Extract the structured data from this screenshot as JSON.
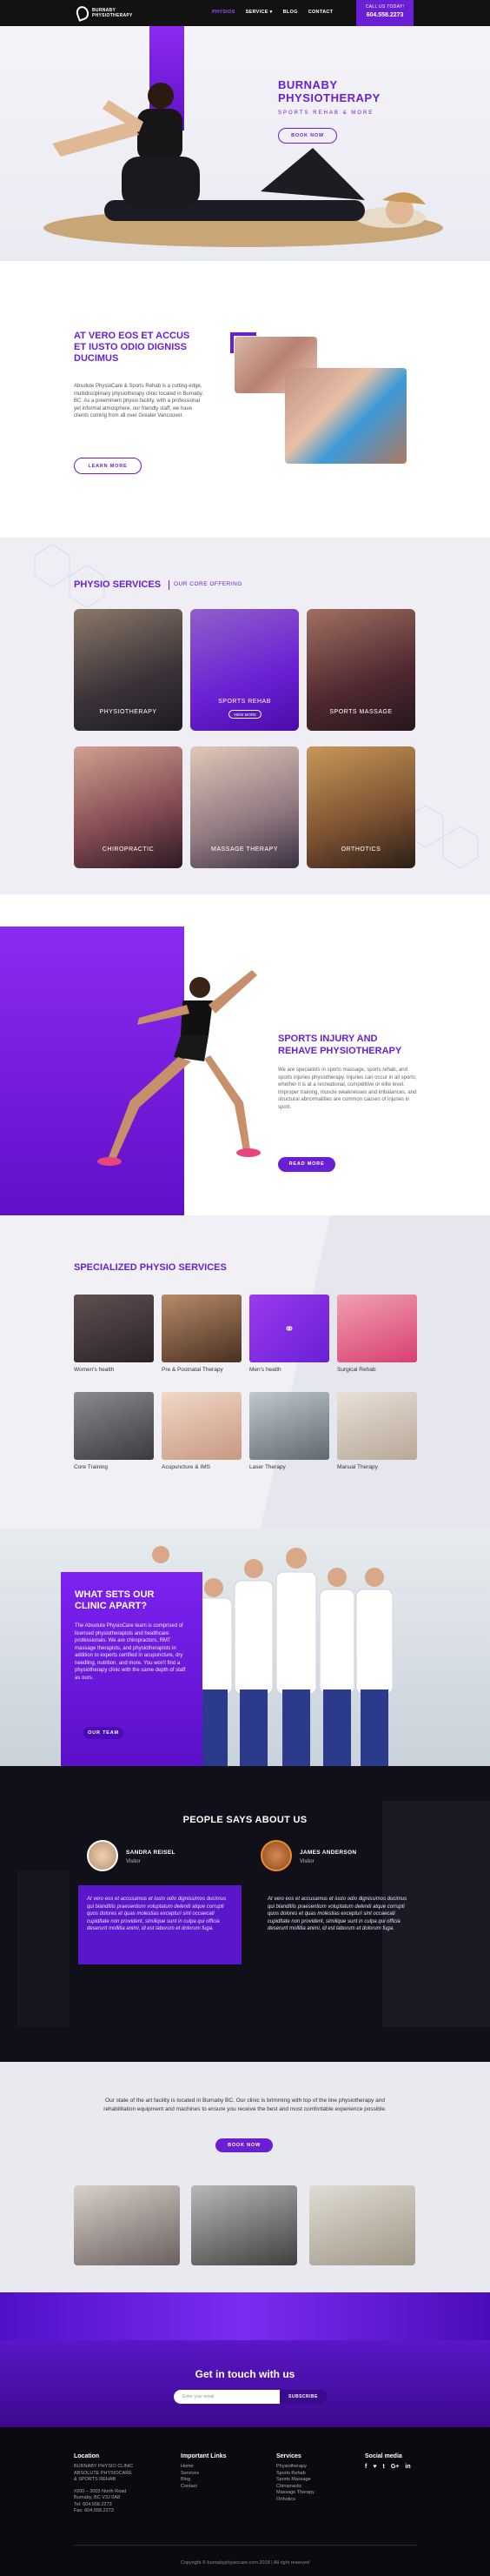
{
  "header": {
    "logo_text": "BURNABY PHYSIOTHERAPY",
    "nav": [
      "PHYSIOS",
      "SERVICE ▾",
      "BLOG",
      "CONTACT"
    ],
    "call_label": "CALL US TODAY!",
    "call_number": "604.558.2273"
  },
  "hero": {
    "title_l1": "BURNABY",
    "title_l2": "PHYSIOTHERAPY",
    "subtitle": "SPORTS REHAB & MORE",
    "button": "BOOK NOW"
  },
  "about": {
    "title": "AT VERO EOS ET ACCUS ET IUSTO ODIO DIGNISS DUCIMUS",
    "text": "Absolute PhysioCare & Sports Rehab is a cutting-edge, multidisciplinary physiotherapy clinic located in Burnaby, BC. As a preeminent physio facility, with a professional yet informal atmosphere, our friendly staff, we have clients coming from all over Greater Vancouver.",
    "button": "LEARN MORE"
  },
  "services": {
    "title": "PHYSIO SERVICES",
    "subtitle": "OUR CORE OFFERING",
    "cards": [
      {
        "label": "PHYSIOTHERAPY"
      },
      {
        "label": "SPORTS REHAB",
        "button": "VIEW MORE"
      },
      {
        "label": "SPORTS MASSAGE"
      },
      {
        "label": "CHIROPRACTIC"
      },
      {
        "label": "MASSAGE THERAPY"
      },
      {
        "label": "ORTHOTICS"
      }
    ]
  },
  "injury": {
    "title_l1": "SPORTS INJURY AND",
    "title_l2": "REHAVE PHYSIOTHERAPY",
    "text": "We are specialists in sports massage, sports rehab, and sports injuries physiotherapy. Injuries can occur in all sports; whether it is at a recreational, competitive or elite level. Improper training, muscle weaknesses and imbalances, and structural abnormalities are common causes of injuries in sport.",
    "button": "READ MORE"
  },
  "specialized": {
    "title": "SPECIALIZED PHYSIO SERVICES",
    "items": [
      "Women's health",
      "Pre & Postnatal Therapy",
      "Men's health",
      "Surgical Rehab",
      "Core Training",
      "Acupuncture & IMS",
      "Laser Therapy",
      "Manual Therapy"
    ]
  },
  "team": {
    "title_l1": "WHAT SETS OUR",
    "title_l2": "CLINIC APART?",
    "text": "The Absolute PhysioCare team is comprised of licensed physiotherapists and healthcare professionals. We are chiropractors, RMT massage therapists, and physiotherapists in addition to experts certified in acupuncture, dry needling, nutrition, and more. You won't find a physiotherapy clinic with the same depth of staff as ours.",
    "button": "OUR TEAM"
  },
  "testimonials": {
    "title": "PEOPLE SAYS ABOUT US",
    "items": [
      {
        "name": "SANDRA REISEL",
        "role": "Visitor",
        "quote": "At vero eos et accusamus et iusto odio dignissimos ducimus qui blanditiis praesentium voluptatum deleniti atque corrupti quos dolores et quas molestias excepturi sint occaecati cupiditate non provident, similique sunt in culpa qui officia deserunt mollitia animi, id est laborum et dolorum fuga."
      },
      {
        "name": "JAMES ANDERSON",
        "role": "Visitor",
        "quote": "At vero eos et accusamus et iusto odio dignissimos ducimus qui blanditiis praesentium voluptatum deleniti atque corrupti quos dolores et quas molestias excepturi sint occaecati cupiditate non provident, similique sunt in culpa qui officia deserunt mollitia animi, id est laborum et dolorum fuga."
      }
    ]
  },
  "facility": {
    "text": "Our state of the art facility is located in Burnaby BC. Our clinic is brimming with top of the line physiotherapy and rehabilitation equipment and machines to ensure you receive the best and most comfortable experience possible.",
    "button": "BOOK NOW"
  },
  "contact": {
    "title": "Get in touch with us",
    "email_placeholder": "Enter your email",
    "button": "SUBSCRIBE"
  },
  "footer": {
    "location_head": "Location",
    "location_lines": [
      "BURNABY PHYSIO CLINIC",
      "ABSOLUTE PHYSIOCARE",
      "& SPORTS REHAB",
      "",
      "#200 – 3003 North Road",
      "Burnaby, BC V3J 0A8",
      "Tel: 604.558.2273",
      "Fax: 604.558.2273"
    ],
    "links_head": "Important Links",
    "links": [
      "Home",
      "Services",
      "Blog",
      "Contact"
    ],
    "services_head": "Services",
    "services": [
      "Physiotherapy",
      "Sports Rehab",
      "Sports Massage",
      "Chiropractic",
      "Massage Therapy",
      "Orthotics"
    ],
    "social_head": "Social media",
    "social": [
      "f",
      "♥",
      "t",
      "G+",
      "in"
    ],
    "copyright": "Copyright © burnabyphysiocare.com 2018 | All right reserved"
  }
}
